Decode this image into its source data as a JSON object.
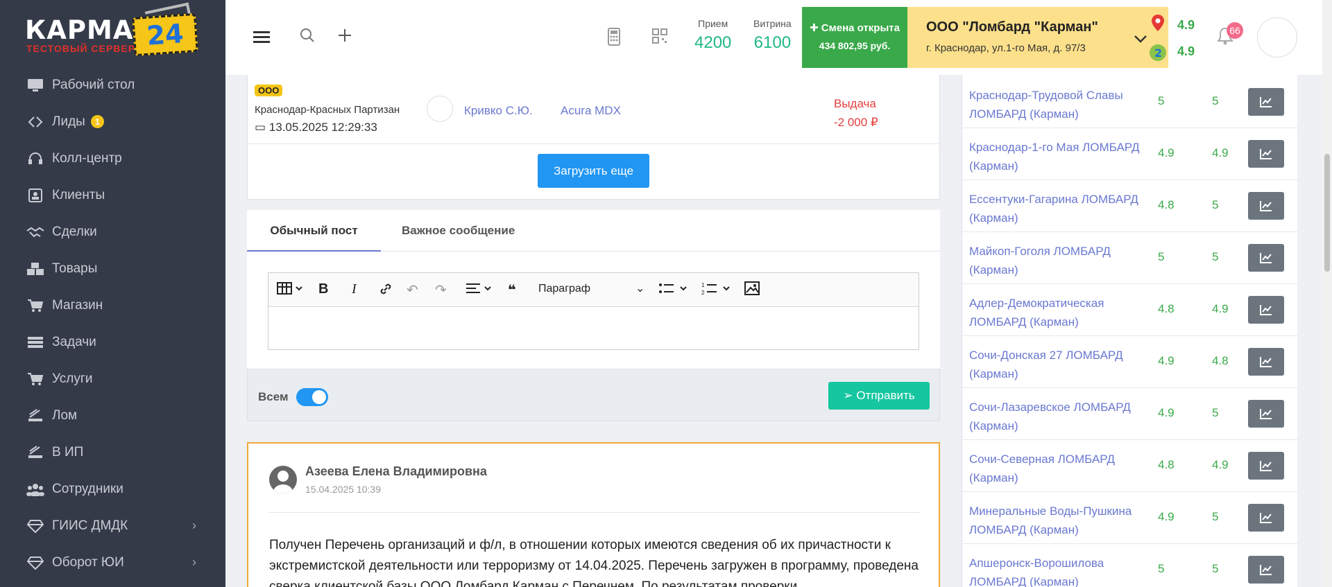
{
  "logo": {
    "brand": "КАРМАН",
    "num": "24",
    "sub": "ТЕСТОВЫЙ СЕРВЕР"
  },
  "sidebar": {
    "items": [
      {
        "label": "Рабочий стол",
        "icon": "monitor-icon"
      },
      {
        "label": "Лиды",
        "icon": "diamond-arrows-icon",
        "badge": "1"
      },
      {
        "label": "Колл-центр",
        "icon": "headset-icon"
      },
      {
        "label": "Клиенты",
        "icon": "contact-card-icon"
      },
      {
        "label": "Сделки",
        "icon": "handshake-icon"
      },
      {
        "label": "Товары",
        "icon": "boxes-icon"
      },
      {
        "label": "Магазин",
        "icon": "cart-icon"
      },
      {
        "label": "Задачи",
        "icon": "tasks-icon"
      },
      {
        "label": "Услуги",
        "icon": "cart-icon"
      },
      {
        "label": "Лом",
        "icon": "scrap-icon"
      },
      {
        "label": "В ИП",
        "icon": "scrap-icon"
      },
      {
        "label": "Сотрудники",
        "icon": "users-icon"
      },
      {
        "label": "ГИИС ДМДК",
        "icon": "gem-icon",
        "chevron": true
      },
      {
        "label": "Оборот ЮИ",
        "icon": "gem-icon",
        "chevron": true
      }
    ]
  },
  "header": {
    "priem_label": "Прием",
    "priem_value": "4200",
    "vitrina_label": "Витрина",
    "vitrina_value": "6100",
    "shift_status": "Смена открыта",
    "shift_amount": "434 802,95 руб.",
    "org_name": "ООО \"Ломбард \"Карман\"",
    "org_address": "г. Краснодар, ул.1-го Мая, д. 97/3",
    "rating_1": "4.9",
    "rating_2": "4.9",
    "notifications": "66"
  },
  "deal": {
    "tag": "ООО",
    "branch": "Краснодар-Красных Партизан",
    "datetime": "13.05.2025 12:29:33",
    "employee": "Кривко С.Ю.",
    "car": "Acura MDX",
    "type": "Выдача",
    "amount": "-2 000 ₽"
  },
  "load_more": "Загрузить еще",
  "post": {
    "tab_regular": "Обычный пост",
    "tab_important": "Важное сообщение",
    "paragraph_select": "Параграф",
    "all_label": "Всем",
    "send_label": "Отправить"
  },
  "message": {
    "author": "Азеева Елена Владимировна",
    "time": "15.04.2025 10:39",
    "text": "Получен Перечень организаций и ф/л, в отношении которых имеются сведения об их причастности к экстремистской деятельности или терроризму от 14.04.2025. Перечень загружен в программу, проведена сверка клиентской базы ООО Ломбард Карман с Перечнем. По результатам проверки"
  },
  "branches": [
    {
      "name": "Краснодар-Трудовой Славы ЛОМБАРД (Карман)",
      "v1": "5",
      "v2": "5"
    },
    {
      "name": "Краснодар-1-го Мая ЛОМБАРД (Карман)",
      "v1": "4.9",
      "v2": "4.9"
    },
    {
      "name": "Ессентуки-Гагарина ЛОМБАРД (Карман)",
      "v1": "4.8",
      "v2": "5"
    },
    {
      "name": "Майкоп-Гоголя ЛОМБАРД (Карман)",
      "v1": "5",
      "v2": "5"
    },
    {
      "name": "Адлер-Демократическая ЛОМБАРД (Карман)",
      "v1": "4.8",
      "v2": "4.9"
    },
    {
      "name": "Сочи-Донская 27 ЛОМБАРД (Карман)",
      "v1": "4.9",
      "v2": "4.8"
    },
    {
      "name": "Сочи-Лазаревское ЛОМБАРД (Карман)",
      "v1": "4.9",
      "v2": "5"
    },
    {
      "name": "Сочи-Северная ЛОМБАРД (Карман)",
      "v1": "4.8",
      "v2": "4.9"
    },
    {
      "name": "Минеральные Воды-Пушкина ЛОМБАРД (Карман)",
      "v1": "4.9",
      "v2": "5"
    },
    {
      "name": "Апшеронск-Ворошилова ЛОМБАРД (Карман)",
      "v1": "5",
      "v2": "5"
    }
  ],
  "colors": {
    "sidebar": "#343a48",
    "accent": "#2196f3",
    "success": "#3aa94a",
    "org": "#fde08b",
    "link": "#6a78d1"
  }
}
